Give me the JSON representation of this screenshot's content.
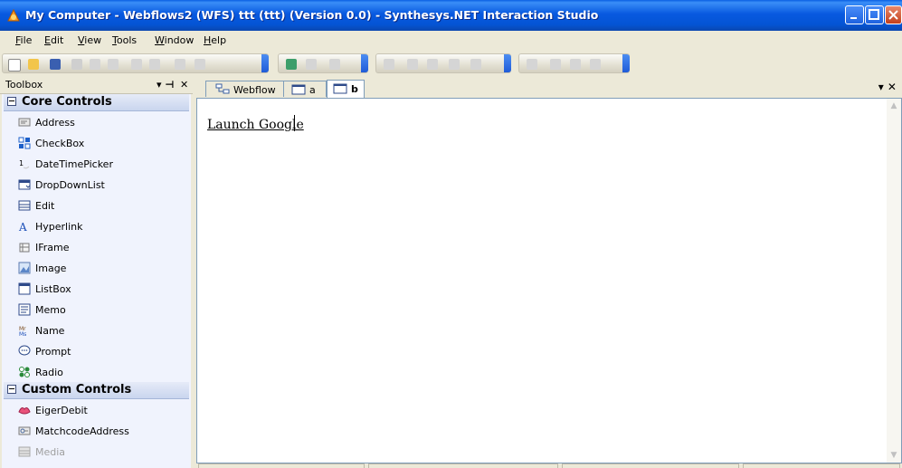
{
  "window": {
    "title": "My Computer - Webflows2 (WFS) ttt (ttt) (Version 0.0) - Synthesys.NET Interaction Studio"
  },
  "menu": {
    "items": [
      {
        "label": "File",
        "key": "F",
        "rest": "ile"
      },
      {
        "label": "Edit",
        "key": "E",
        "rest": "dit"
      },
      {
        "label": "View",
        "key": "V",
        "rest": "iew"
      },
      {
        "label": "Tools",
        "key": "T",
        "rest": "ools"
      },
      {
        "label": "Window",
        "key": "W",
        "rest": "indow"
      },
      {
        "label": "Help",
        "key": "H",
        "rest": "elp"
      }
    ]
  },
  "toolbox": {
    "title": "Toolbox",
    "pin_glyph": "▾ ⊣",
    "close_glyph": "✕",
    "sections": [
      {
        "label": "Core Controls",
        "items": [
          {
            "label": "Address",
            "icon": "address-icon"
          },
          {
            "label": "CheckBox",
            "icon": "checkbox-icon"
          },
          {
            "label": "DateTimePicker",
            "icon": "datetimepicker-icon"
          },
          {
            "label": "DropDownList",
            "icon": "dropdownlist-icon"
          },
          {
            "label": "Edit",
            "icon": "edit-icon"
          },
          {
            "label": "Hyperlink",
            "icon": "hyperlink-icon"
          },
          {
            "label": "IFrame",
            "icon": "iframe-icon"
          },
          {
            "label": "Image",
            "icon": "image-icon"
          },
          {
            "label": "ListBox",
            "icon": "listbox-icon"
          },
          {
            "label": "Memo",
            "icon": "memo-icon"
          },
          {
            "label": "Name",
            "icon": "name-icon"
          },
          {
            "label": "Prompt",
            "icon": "prompt-icon"
          },
          {
            "label": "Radio",
            "icon": "radio-icon"
          }
        ]
      },
      {
        "label": "Custom Controls",
        "items": [
          {
            "label": "EigerDebit",
            "icon": "eigerdebit-icon"
          },
          {
            "label": "MatchcodeAddress",
            "icon": "matchcodeaddress-icon"
          },
          {
            "label": "Media",
            "icon": "media-icon"
          }
        ]
      }
    ]
  },
  "document": {
    "tabs": [
      {
        "label": "Webflow",
        "icon": "webflow-icon",
        "active": false
      },
      {
        "label": "a",
        "icon": "page-icon",
        "active": false
      },
      {
        "label": "b",
        "icon": "page-icon",
        "active": true
      }
    ],
    "tab_menu_glyph": "▾ ✕",
    "content": {
      "link_text": "Launch Google"
    }
  },
  "colors": {
    "title_bar": "#0454d4",
    "panel_background": "#f0f3fd",
    "section_header": "#c9d5ee",
    "editor_background": "#ffffff"
  }
}
